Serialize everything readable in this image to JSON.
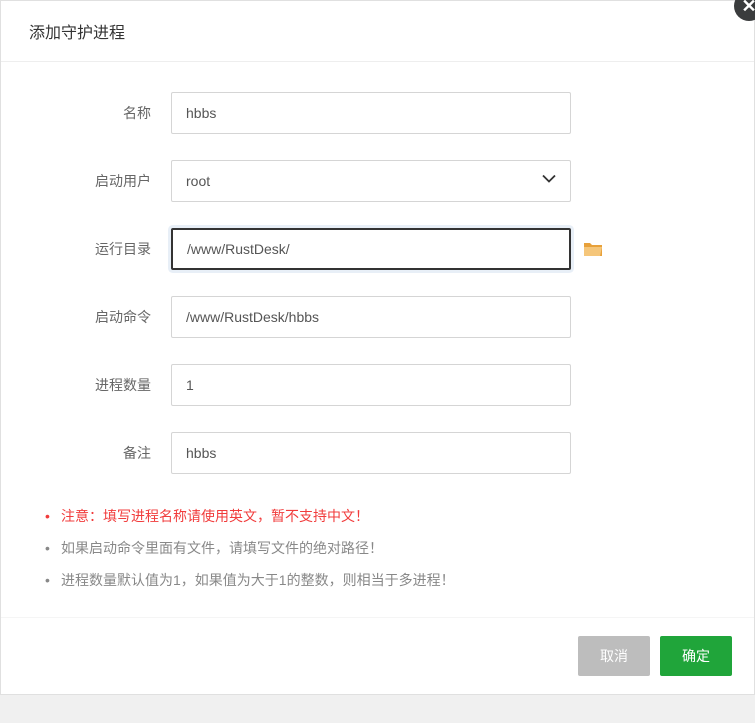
{
  "modal": {
    "title": "添加守护进程"
  },
  "form": {
    "name": {
      "label": "名称",
      "value": "hbbs"
    },
    "user": {
      "label": "启动用户",
      "value": "root"
    },
    "run_dir": {
      "label": "运行目录",
      "value": "/www/RustDesk/"
    },
    "start_cmd": {
      "label": "启动命令",
      "value": "/www/RustDesk/hbbs"
    },
    "proc_count": {
      "label": "进程数量",
      "value": "1"
    },
    "remark": {
      "label": "备注",
      "value": "hbbs"
    }
  },
  "notes": {
    "note1": "注意：填写进程名称请使用英文，暂不支持中文！",
    "note2": "如果启动命令里面有文件，请填写文件的绝对路径！",
    "note3": "进程数量默认值为1，如果值为大于1的整数，则相当于多进程！"
  },
  "footer": {
    "cancel": "取消",
    "confirm": "确定"
  }
}
